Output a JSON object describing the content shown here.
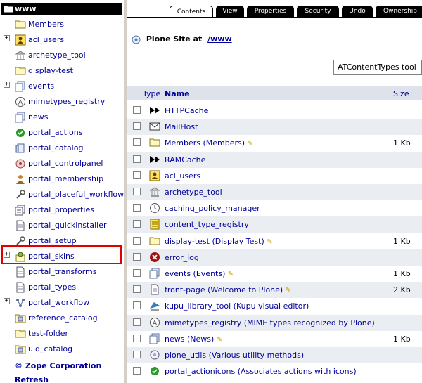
{
  "tree": {
    "root": "www",
    "items": [
      {
        "label": "Members",
        "icon": "folder-icon",
        "plus": false
      },
      {
        "label": "acl_users",
        "icon": "acl-users-icon",
        "plus": true
      },
      {
        "label": "archetype_tool",
        "icon": "archetype-tool-icon",
        "plus": false
      },
      {
        "label": "display-test",
        "icon": "folder-icon",
        "plus": false
      },
      {
        "label": "events",
        "icon": "topic-icon",
        "plus": true
      },
      {
        "label": "mimetypes_registry",
        "icon": "mimetypes-icon",
        "plus": false
      },
      {
        "label": "news",
        "icon": "topic-icon",
        "plus": false
      },
      {
        "label": "portal_actions",
        "icon": "check-icon",
        "plus": false
      },
      {
        "label": "portal_catalog",
        "icon": "catalog-icon",
        "plus": false
      },
      {
        "label": "portal_controlpanel",
        "icon": "controlpanel-icon",
        "plus": false
      },
      {
        "label": "portal_membership",
        "icon": "member-icon",
        "plus": false
      },
      {
        "label": "portal_placeful_workflow",
        "icon": "wrench-icon",
        "plus": false
      },
      {
        "label": "portal_properties",
        "icon": "properties-icon",
        "plus": false
      },
      {
        "label": "portal_quickinstaller",
        "icon": "document-icon",
        "plus": false
      },
      {
        "label": "portal_setup",
        "icon": "wrench-icon",
        "plus": false
      },
      {
        "label": "portal_skins",
        "icon": "skins-icon",
        "plus": true
      },
      {
        "label": "portal_transforms",
        "icon": "document-icon",
        "plus": false
      },
      {
        "label": "portal_types",
        "icon": "document-icon",
        "plus": false
      },
      {
        "label": "portal_workflow",
        "icon": "workflow-icon",
        "plus": true
      },
      {
        "label": "reference_catalog",
        "icon": "catalog-folder-icon",
        "plus": false
      },
      {
        "label": "test-folder",
        "icon": "folder-icon",
        "plus": false
      },
      {
        "label": "uid_catalog",
        "icon": "catalog-folder-icon",
        "plus": false
      }
    ],
    "copyright": "© Zope Corporation",
    "refresh": "Refresh"
  },
  "tabs": [
    "Contents",
    "View",
    "Properties",
    "Security",
    "Undo",
    "Ownership"
  ],
  "active_tab": "Contents",
  "site": {
    "prefix": "Plone Site at",
    "path": "/www"
  },
  "add_select": {
    "value": "ATContentTypes tool"
  },
  "table": {
    "col_type": "Type",
    "col_name": "Name",
    "col_size": "Size",
    "rows": [
      {
        "name": "HTTPCache",
        "icon": "fast-forward-icon",
        "size": "",
        "pencil": false
      },
      {
        "name": "MailHost",
        "icon": "mailhost-icon",
        "size": "",
        "pencil": false
      },
      {
        "name": "Members (Members)",
        "icon": "folder-icon",
        "size": "1 Kb",
        "pencil": true
      },
      {
        "name": "RAMCache",
        "icon": "fast-forward-icon",
        "size": "",
        "pencil": false
      },
      {
        "name": "acl_users",
        "icon": "acl-users-icon",
        "size": "",
        "pencil": false
      },
      {
        "name": "archetype_tool",
        "icon": "archetype-tool-icon",
        "size": "",
        "pencil": false
      },
      {
        "name": "caching_policy_manager",
        "icon": "caching-icon",
        "size": "",
        "pencil": false
      },
      {
        "name": "content_type_registry",
        "icon": "registry-icon",
        "size": "",
        "pencil": false
      },
      {
        "name": "display-test (Display Test)",
        "icon": "folder-icon",
        "size": "1 Kb",
        "pencil": true
      },
      {
        "name": "error_log",
        "icon": "error-icon",
        "size": "",
        "pencil": false
      },
      {
        "name": "events (Events)",
        "icon": "topic-icon",
        "size": "1 Kb",
        "pencil": true
      },
      {
        "name": "front-page (Welcome to Plone)",
        "icon": "document-icon",
        "size": "2 Kb",
        "pencil": true
      },
      {
        "name": "kupu_library_tool (Kupu visual editor)",
        "icon": "kupu-icon",
        "size": "",
        "pencil": false
      },
      {
        "name": "mimetypes_registry (MIME types recognized by Plone)",
        "icon": "mimetypes-icon",
        "size": "",
        "pencil": false
      },
      {
        "name": "news (News)",
        "icon": "topic-icon",
        "size": "1 Kb",
        "pencil": true
      },
      {
        "name": "plone_utils (Various utility methods)",
        "icon": "utils-icon",
        "size": "",
        "pencil": false
      },
      {
        "name": "portal_actionicons (Associates actions with icons)",
        "icon": "check-icon",
        "size": "",
        "pencil": false
      }
    ]
  }
}
